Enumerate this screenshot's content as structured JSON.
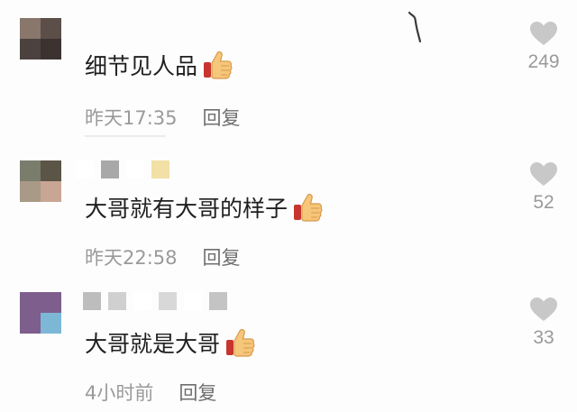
{
  "comments": [
    {
      "text": "细节见人品",
      "time": "昨天17:35",
      "reply": "回复",
      "likes": "249",
      "avatar_colors": [
        "#8a776c",
        "#5c4f4a",
        "#4b4240",
        "#3c3331"
      ],
      "name_blocks": []
    },
    {
      "text": "大哥就有大哥的样子",
      "time": "昨天22:58",
      "reply": "回复",
      "likes": "52",
      "avatar_colors": [
        "#7a7d6c",
        "#5a5546",
        "#a89a86",
        "#c9a594"
      ],
      "name_blocks": [
        "#ffffff",
        "#a8a8a8",
        "#ffffff",
        "#f2e0a6"
      ]
    },
    {
      "text": "大哥就是大哥",
      "time": "4小时前",
      "reply": "回复",
      "likes": "33",
      "avatar_colors": [
        "#7e5e8c",
        "#7e5e8c",
        "#7e5e8c",
        "#7cb8d6"
      ],
      "name_blocks": [
        "#bdbdbd",
        "#d0d0d0",
        "#ffffff",
        "#d8d8d8",
        "#ffffff",
        "#c4c4c4"
      ]
    }
  ],
  "colors": {
    "text": "#1f1f1f",
    "meta": "#9a9a9a",
    "heart": "#c8c8c8"
  },
  "icons": [
    "thumbs-up-icon",
    "heart-icon"
  ]
}
